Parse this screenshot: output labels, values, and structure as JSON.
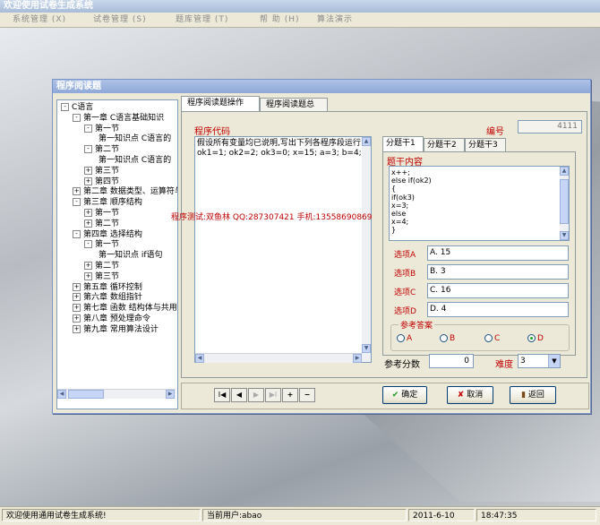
{
  "app": {
    "title": "欢迎使用试卷生成系统"
  },
  "menu": [
    {
      "label": "系统管理 (X)"
    },
    {
      "label": "试卷管理 (S)"
    },
    {
      "label": "题库管理 (T)"
    },
    {
      "label": "帮 助 (H)"
    },
    {
      "label": "算法演示"
    }
  ],
  "window": {
    "title": "程序阅读题"
  },
  "tree": [
    {
      "label": "C语言",
      "pm": "-"
    },
    {
      "label": "第一章 C语言基础知识",
      "pm": "-"
    },
    {
      "label": "第一节",
      "pm": "-"
    },
    {
      "label": "第一知识点 C语言的",
      "pm": ""
    },
    {
      "label": "第二节",
      "pm": "-"
    },
    {
      "label": "第一知识点 C语言的",
      "pm": ""
    },
    {
      "label": "第三节",
      "pm": "+"
    },
    {
      "label": "第四节",
      "pm": "+"
    },
    {
      "label": "第二章 数据类型、运算符与",
      "pm": "+"
    },
    {
      "label": "第三章 顺序结构",
      "pm": "-"
    },
    {
      "label": "第一节",
      "pm": "+"
    },
    {
      "label": "第二节",
      "pm": "+"
    },
    {
      "label": "第四章 选择结构",
      "pm": "-"
    },
    {
      "label": "第一节",
      "pm": "-"
    },
    {
      "label": "第一知识点 if语句",
      "pm": ""
    },
    {
      "label": "第二节",
      "pm": "+"
    },
    {
      "label": "第三节",
      "pm": "+"
    },
    {
      "label": "第五章 循环控制",
      "pm": "+"
    },
    {
      "label": "第六章 数组指针",
      "pm": "+"
    },
    {
      "label": "第七章 函数 结构体与共用",
      "pm": "+"
    },
    {
      "label": "第八章 预处理命令",
      "pm": "+"
    },
    {
      "label": "第九章 常用算法设计",
      "pm": "+"
    }
  ],
  "tabs": {
    "operate": "程序阅读题操作",
    "overview": "程序阅读题总览"
  },
  "code": {
    "label": "程序代码",
    "text_line1": "假设所有变量均已说明,写出下列各程序段运行",
    "text_line2": "ok1=1; ok2=2; ok3=0; x=15; a=3; b=4;",
    "watermark": "程序测试:双鱼林 QQ:287307421 手机:13558690869"
  },
  "number": {
    "label": "编号",
    "value": "4111"
  },
  "subtabs": [
    "分题干1",
    "分题干2",
    "分题干3"
  ],
  "stem": {
    "label": "题干内容",
    "lines": [
      "x++;",
      "else if(ok2)",
      "{",
      "if(ok3)",
      "x=3;",
      "else",
      "x=4;",
      "}"
    ]
  },
  "options": [
    {
      "label": "选项A",
      "value": "A. 15"
    },
    {
      "label": "选项B",
      "value": "B. 3"
    },
    {
      "label": "选项C",
      "value": "C. 16"
    },
    {
      "label": "选项D",
      "value": "D. 4"
    }
  ],
  "answer": {
    "label": "参考答案",
    "choices": [
      "A",
      "B",
      "C",
      "D"
    ],
    "selected": "D"
  },
  "score": {
    "label": "参考分数",
    "value": "0"
  },
  "difficulty": {
    "label": "难度",
    "value": "3"
  },
  "nav": {
    "first": "I◀",
    "prev": "◀",
    "next": "▶",
    "last": "▶I",
    "add": "+",
    "del": "−"
  },
  "buttons": {
    "ok": "确定",
    "cancel": "取消",
    "back": "返回"
  },
  "status": {
    "welcome": "欢迎使用通用试卷生成系统!",
    "user": "当前用户:abao",
    "date": "2011-6-10",
    "time": "18:47:35"
  }
}
